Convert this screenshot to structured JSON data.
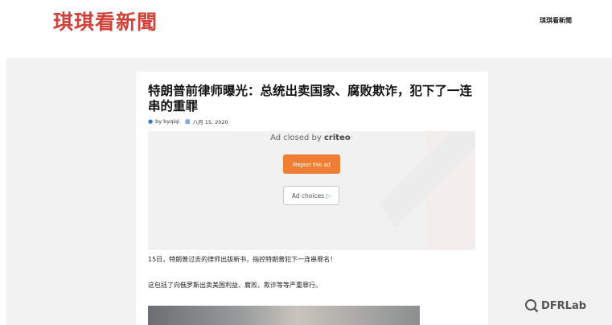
{
  "site": {
    "title": "琪琪看新聞",
    "nav_item": "琪琪看新聞"
  },
  "post": {
    "title": "特朗普前律师曝光：总统出卖国家、腐败欺诈，犯下了一连串的重罪",
    "author": "by byqiqi",
    "date": "八月 15, 2020",
    "paragraphs": [
      "15日，特朗普过去的律师出版新书，指控特朗普犯下一连串罪名！",
      "这包括了向俄罗斯出卖美国利益、腐败、欺诈等等严重罪行。"
    ]
  },
  "ad": {
    "closed_prefix": "Ad closed by ",
    "brand": "criteo",
    "brand_mark": "·",
    "report_label": "Report this ad",
    "choices_label": "Ad choices",
    "choices_icon": "▷"
  },
  "icons": {
    "author": "person-icon",
    "date": "calendar-icon"
  },
  "colors": {
    "site_title": "#d0433b",
    "report_button": "#ee7e33",
    "meta_icon": "#3e74c9"
  },
  "watermark": {
    "text": "DFRLab"
  }
}
